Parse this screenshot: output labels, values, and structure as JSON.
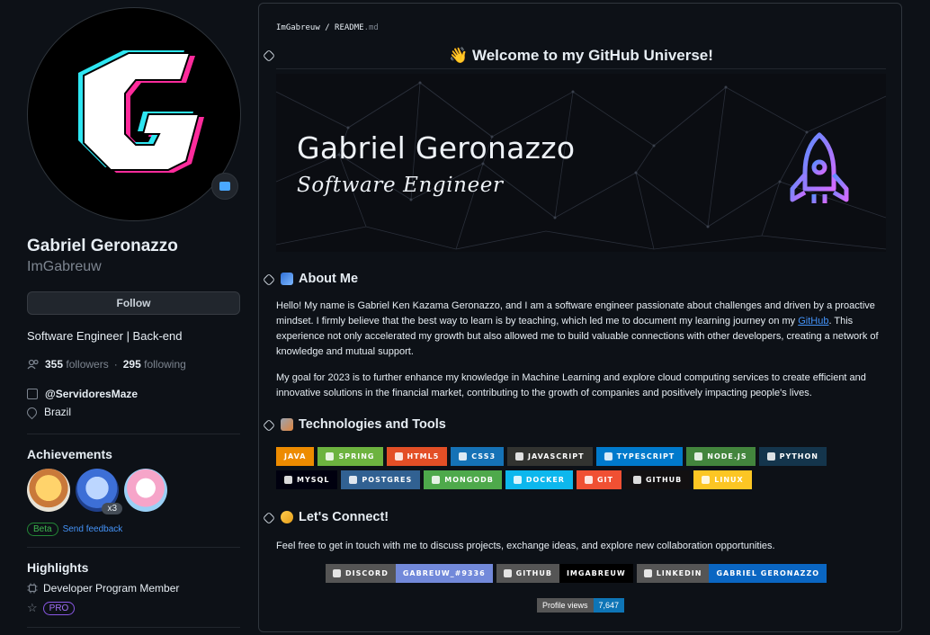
{
  "profile": {
    "name": "Gabriel Geronazzo",
    "login": "ImGabreuw",
    "follow_label": "Follow",
    "bio": "Software Engineer | Back-end",
    "followers_count": "355",
    "followers_label": "followers",
    "separator": "·",
    "following_count": "295",
    "following_label": "following",
    "organization": "@ServidoresMaze",
    "location": "Brazil"
  },
  "achievements": {
    "title": "Achievements",
    "badges": [
      {
        "name": "yolo-cowboy-badge",
        "color": "#f2c06b"
      },
      {
        "name": "pull-shark-badge",
        "color": "#3d6fd6",
        "count": "x3"
      },
      {
        "name": "yolo-badge",
        "color": "#e8589c"
      }
    ],
    "beta_label": "Beta",
    "feedback_label": "Send feedback"
  },
  "highlights": {
    "title": "Highlights",
    "developer_program": "Developer Program Member",
    "pro_label": "PRO"
  },
  "readme": {
    "path_user": "ImGabreuw",
    "path_sep": " / ",
    "path_file": "README",
    "path_ext": ".md",
    "welcome": "👋 Welcome to my GitHub Universe!",
    "banner_name": "Gabriel Geronazzo",
    "banner_role": "Software Engineer",
    "about_title": "About Me",
    "about_p1_before": "Hello! My name is Gabriel Ken Kazama Geronazzo, and I am a software engineer passionate about challenges and driven by a proactive mindset. I firmly believe that the best way to learn is by teaching, which led me to document my learning journey on my ",
    "about_p1_link": "GitHub",
    "about_p1_after": ". This experience not only accelerated my growth but also allowed me to build valuable connections with other developers, creating a network of knowledge and mutual support.",
    "about_p2": "My goal for 2023 is to further enhance my knowledge in Machine Learning and explore cloud computing services to create efficient and innovative solutions in the financial market, contributing to the growth of companies and positively impacting people's lives.",
    "tech_title": "Technologies and Tools",
    "tech_row1": [
      {
        "label": "JAVA",
        "color": "#ed8b00",
        "glyph": false
      },
      {
        "label": "SPRING",
        "color": "#6db33f",
        "glyph": true
      },
      {
        "label": "HTML5",
        "color": "#e34f26",
        "glyph": true
      },
      {
        "label": "CSS3",
        "color": "#1572b6",
        "glyph": true
      },
      {
        "label": "JAVASCRIPT",
        "color": "#323330",
        "glyph": true
      },
      {
        "label": "TYPESCRIPT",
        "color": "#007acc",
        "glyph": true
      },
      {
        "label": "NODE.JS",
        "color": "#43853d",
        "glyph": true
      },
      {
        "label": "PYTHON",
        "color": "#14354c",
        "glyph": true
      }
    ],
    "tech_row2": [
      {
        "label": "MYSQL",
        "color": "#00000f",
        "glyph": true
      },
      {
        "label": "POSTGRES",
        "color": "#316192",
        "glyph": true
      },
      {
        "label": "MONGODB",
        "color": "#4ea94b",
        "glyph": true
      },
      {
        "label": "DOCKER",
        "color": "#0db7ed",
        "glyph": true
      },
      {
        "label": "GIT",
        "color": "#f05033",
        "glyph": true
      },
      {
        "label": "GITHUB",
        "color": "#121011",
        "glyph": true
      },
      {
        "label": "LINUX",
        "color": "#fcc624",
        "glyph": true
      }
    ],
    "connect_title": "Let's Connect!",
    "connect_text": "Feel free to get in touch with me to discuss projects, exchange ideas, and explore new collaboration opportunities.",
    "connect_badges": [
      {
        "left": "DISCORD",
        "left_color": "#555555",
        "right": "GABREUW_#9336",
        "right_color": "#7289da"
      },
      {
        "left": "GITHUB",
        "left_color": "#555555",
        "right": "IMGABREUW",
        "right_color": "#000000"
      },
      {
        "left": "LINKEDIN",
        "left_color": "#555555",
        "right": "GABRIEL GERONAZZO",
        "right_color": "#0a66c2"
      }
    ],
    "views_label": "Profile views",
    "views_count": "7,647"
  }
}
